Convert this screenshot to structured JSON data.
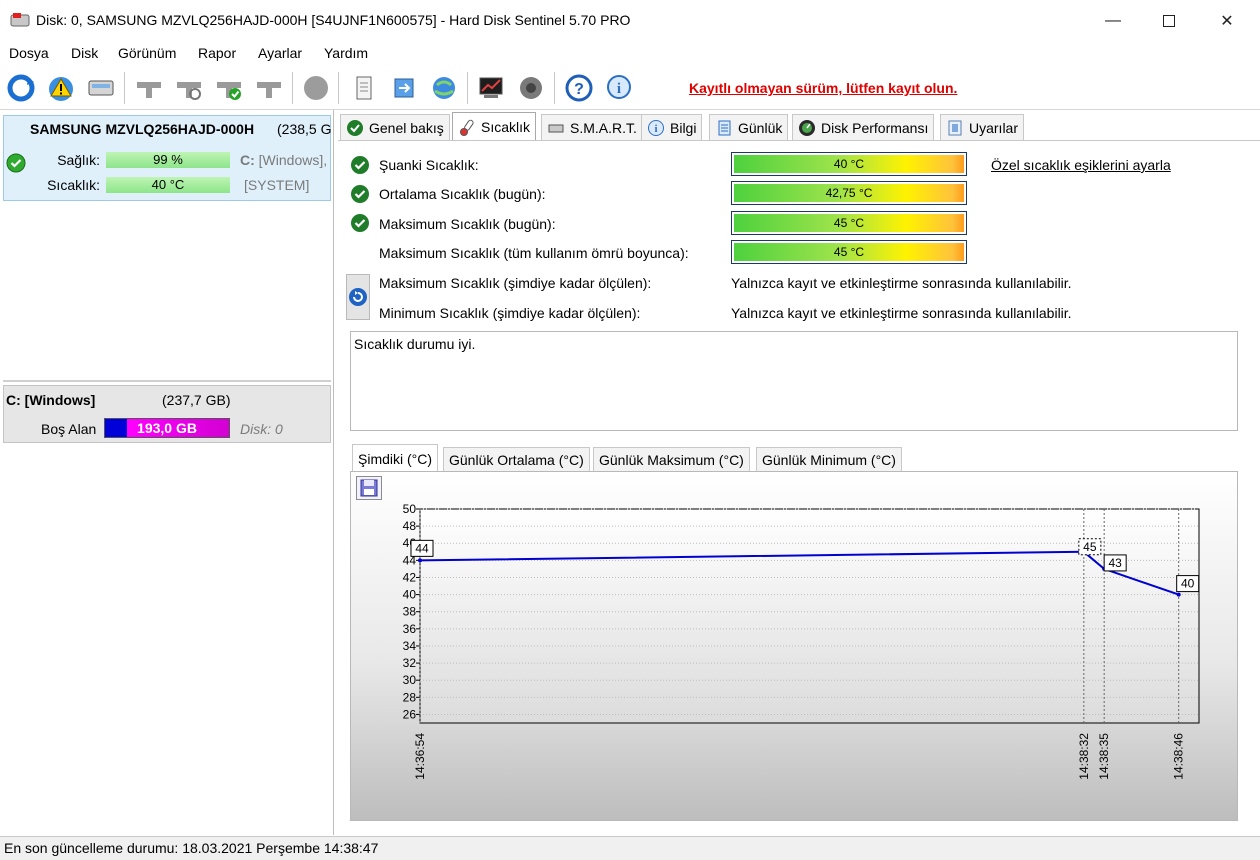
{
  "window": {
    "title": "Disk: 0, SAMSUNG MZVLQ256HAJD-000H [S4UJNF1N600575]  -  Hard Disk Sentinel 5.70 PRO"
  },
  "menu": [
    "Dosya",
    "Disk",
    "Görünüm",
    "Rapor",
    "Ayarlar",
    "Yardım"
  ],
  "toolbar": {
    "register_text": "Kayıtlı olmayan sürüm, lütfen kayıt olun."
  },
  "left": {
    "disk_name": "SAMSUNG MZVLQ256HAJD-000H",
    "disk_size": "(238,5 G",
    "health_label": "Sağlık:",
    "health_value": "99 %",
    "health_fraction": 0.99,
    "health_drive": "C:",
    "health_drive_name": "[Windows],",
    "temp_label": "Sıcaklık:",
    "temp_value": "40 °C",
    "temp_drive": "[SYSTEM]",
    "volume_name": "C: [Windows]",
    "volume_size": "(237,7 GB)",
    "free_label": "Boş Alan",
    "free_value": "193,0 GB",
    "disk_ref": "Disk: 0"
  },
  "tabs": [
    {
      "label": "Genel bakış",
      "icon": "check-icon"
    },
    {
      "label": "Sıcaklık",
      "icon": "thermometer-icon"
    },
    {
      "label": "S.M.A.R.T.",
      "icon": "drive-icon"
    },
    {
      "label": "Bilgi",
      "icon": "info-icon"
    },
    {
      "label": "Günlük",
      "icon": "log-icon"
    },
    {
      "label": "Disk Performansı",
      "icon": "gauge-icon"
    },
    {
      "label": "Uyarılar",
      "icon": "alert-icon"
    }
  ],
  "temperature": {
    "current_label": "Şuanki Sıcaklık:",
    "current_value": "40 °C",
    "avg_label": "Ortalama Sıcaklık (bugün):",
    "avg_value": "42,75 °C",
    "max_today_label": "Maksimum Sıcaklık (bugün):",
    "max_today_value": "45 °C",
    "max_lifetime_label": "Maksimum Sıcaklık (tüm kullanım ömrü boyunca):",
    "max_lifetime_value": "45 °C",
    "max_measured_label": "Maksimum Sıcaklık (şimdiye kadar ölçülen):",
    "max_measured_note": "Yalnızca kayıt ve etkinleştirme sonrasında kullanılabilir.",
    "min_measured_label": "Minimum Sıcaklık (şimdiye kadar ölçülen):",
    "min_measured_note": "Yalnızca kayıt ve etkinleştirme sonrasında kullanılabilir.",
    "threshold_link": "Özel sıcaklık eşiklerini ayarla",
    "status_text": "Sıcaklık durumu iyi."
  },
  "chart_tabs": [
    "Şimdiki (°C)",
    "Günlük Ortalama (°C)",
    "Günlük Maksimum (°C)",
    "Günlük Minimum (°C)"
  ],
  "chart_data": {
    "type": "line",
    "title": "",
    "xlabel": "",
    "ylabel": "",
    "ylim": [
      25,
      50
    ],
    "yticks": [
      26,
      28,
      30,
      32,
      34,
      36,
      38,
      40,
      42,
      44,
      46,
      48,
      50
    ],
    "grid": true,
    "series": [
      {
        "x": [
          "14:36:54",
          "14:38:32",
          "14:38:35",
          "14:38:46"
        ],
        "x_seconds": [
          0,
          98,
          101,
          112
        ],
        "values": [
          44,
          45,
          43,
          40
        ],
        "labels": [
          "44",
          "45",
          "43",
          "40"
        ],
        "color": "#0000d0"
      }
    ],
    "xlim_seconds": [
      0,
      115
    ]
  },
  "statusbar": {
    "text": "En son güncelleme durumu: 18.03.2021 Perşembe 14:38:47"
  }
}
